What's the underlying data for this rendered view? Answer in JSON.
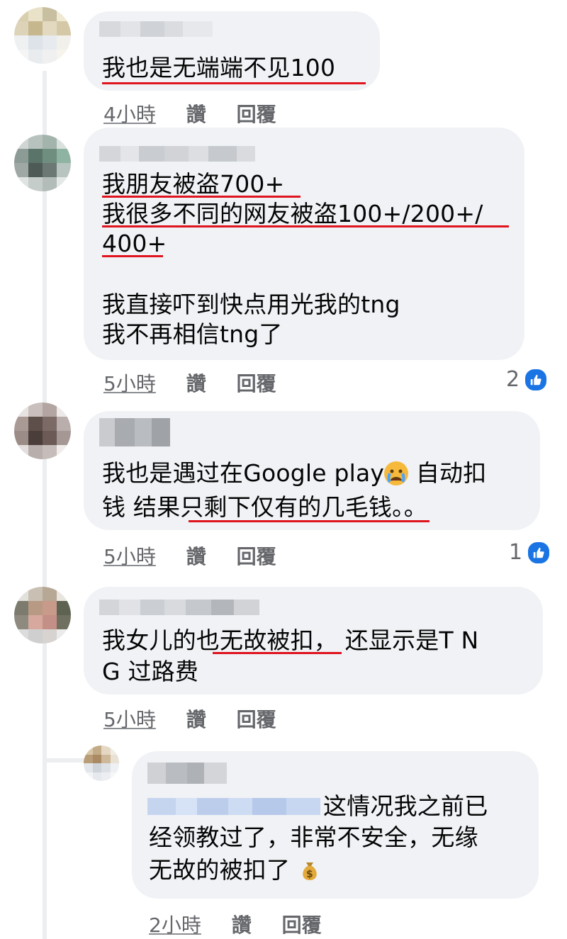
{
  "comments": [
    {
      "lines": [
        "我也是无端端不见100"
      ],
      "meta": {
        "time": "4小時",
        "like": "讚",
        "reply": "回覆"
      }
    },
    {
      "lines": [
        "我朋友被盗700+",
        "我很多不同的网友被盗100+/200+/",
        "400+",
        "我直接吓到快点用光我的tng",
        "我不再相信tng了"
      ],
      "meta": {
        "time": "5小時",
        "like": "讚",
        "reply": "回覆"
      },
      "reactions": "2"
    },
    {
      "line1": "我也是遇过在Google play",
      "line1_rest": " 自动扣",
      "line2": "钱 结果只剩下仅有的几毛钱。。",
      "emoji": "crying-face",
      "meta": {
        "time": "5小時",
        "like": "讚",
        "reply": "回覆"
      },
      "reactions": "1"
    },
    {
      "lines": [
        "我女儿的也无故被扣， 还显示是T N",
        "G 过路费"
      ],
      "meta": {
        "time": "5小時",
        "like": "讚",
        "reply": "回覆"
      }
    },
    {
      "lines": [
        "这情况我之前已",
        "经领教过了，非常不安全，无缘",
        "无故的被扣了"
      ],
      "emoji": "money-bag",
      "meta": {
        "time": "2小時",
        "like": "讚",
        "reply": "回覆"
      }
    }
  ],
  "colors": {
    "bubble": "#f0f2f5",
    "underline": "#e0141e",
    "like_blue": "#1b74e4",
    "meta_gray": "#65676b"
  }
}
